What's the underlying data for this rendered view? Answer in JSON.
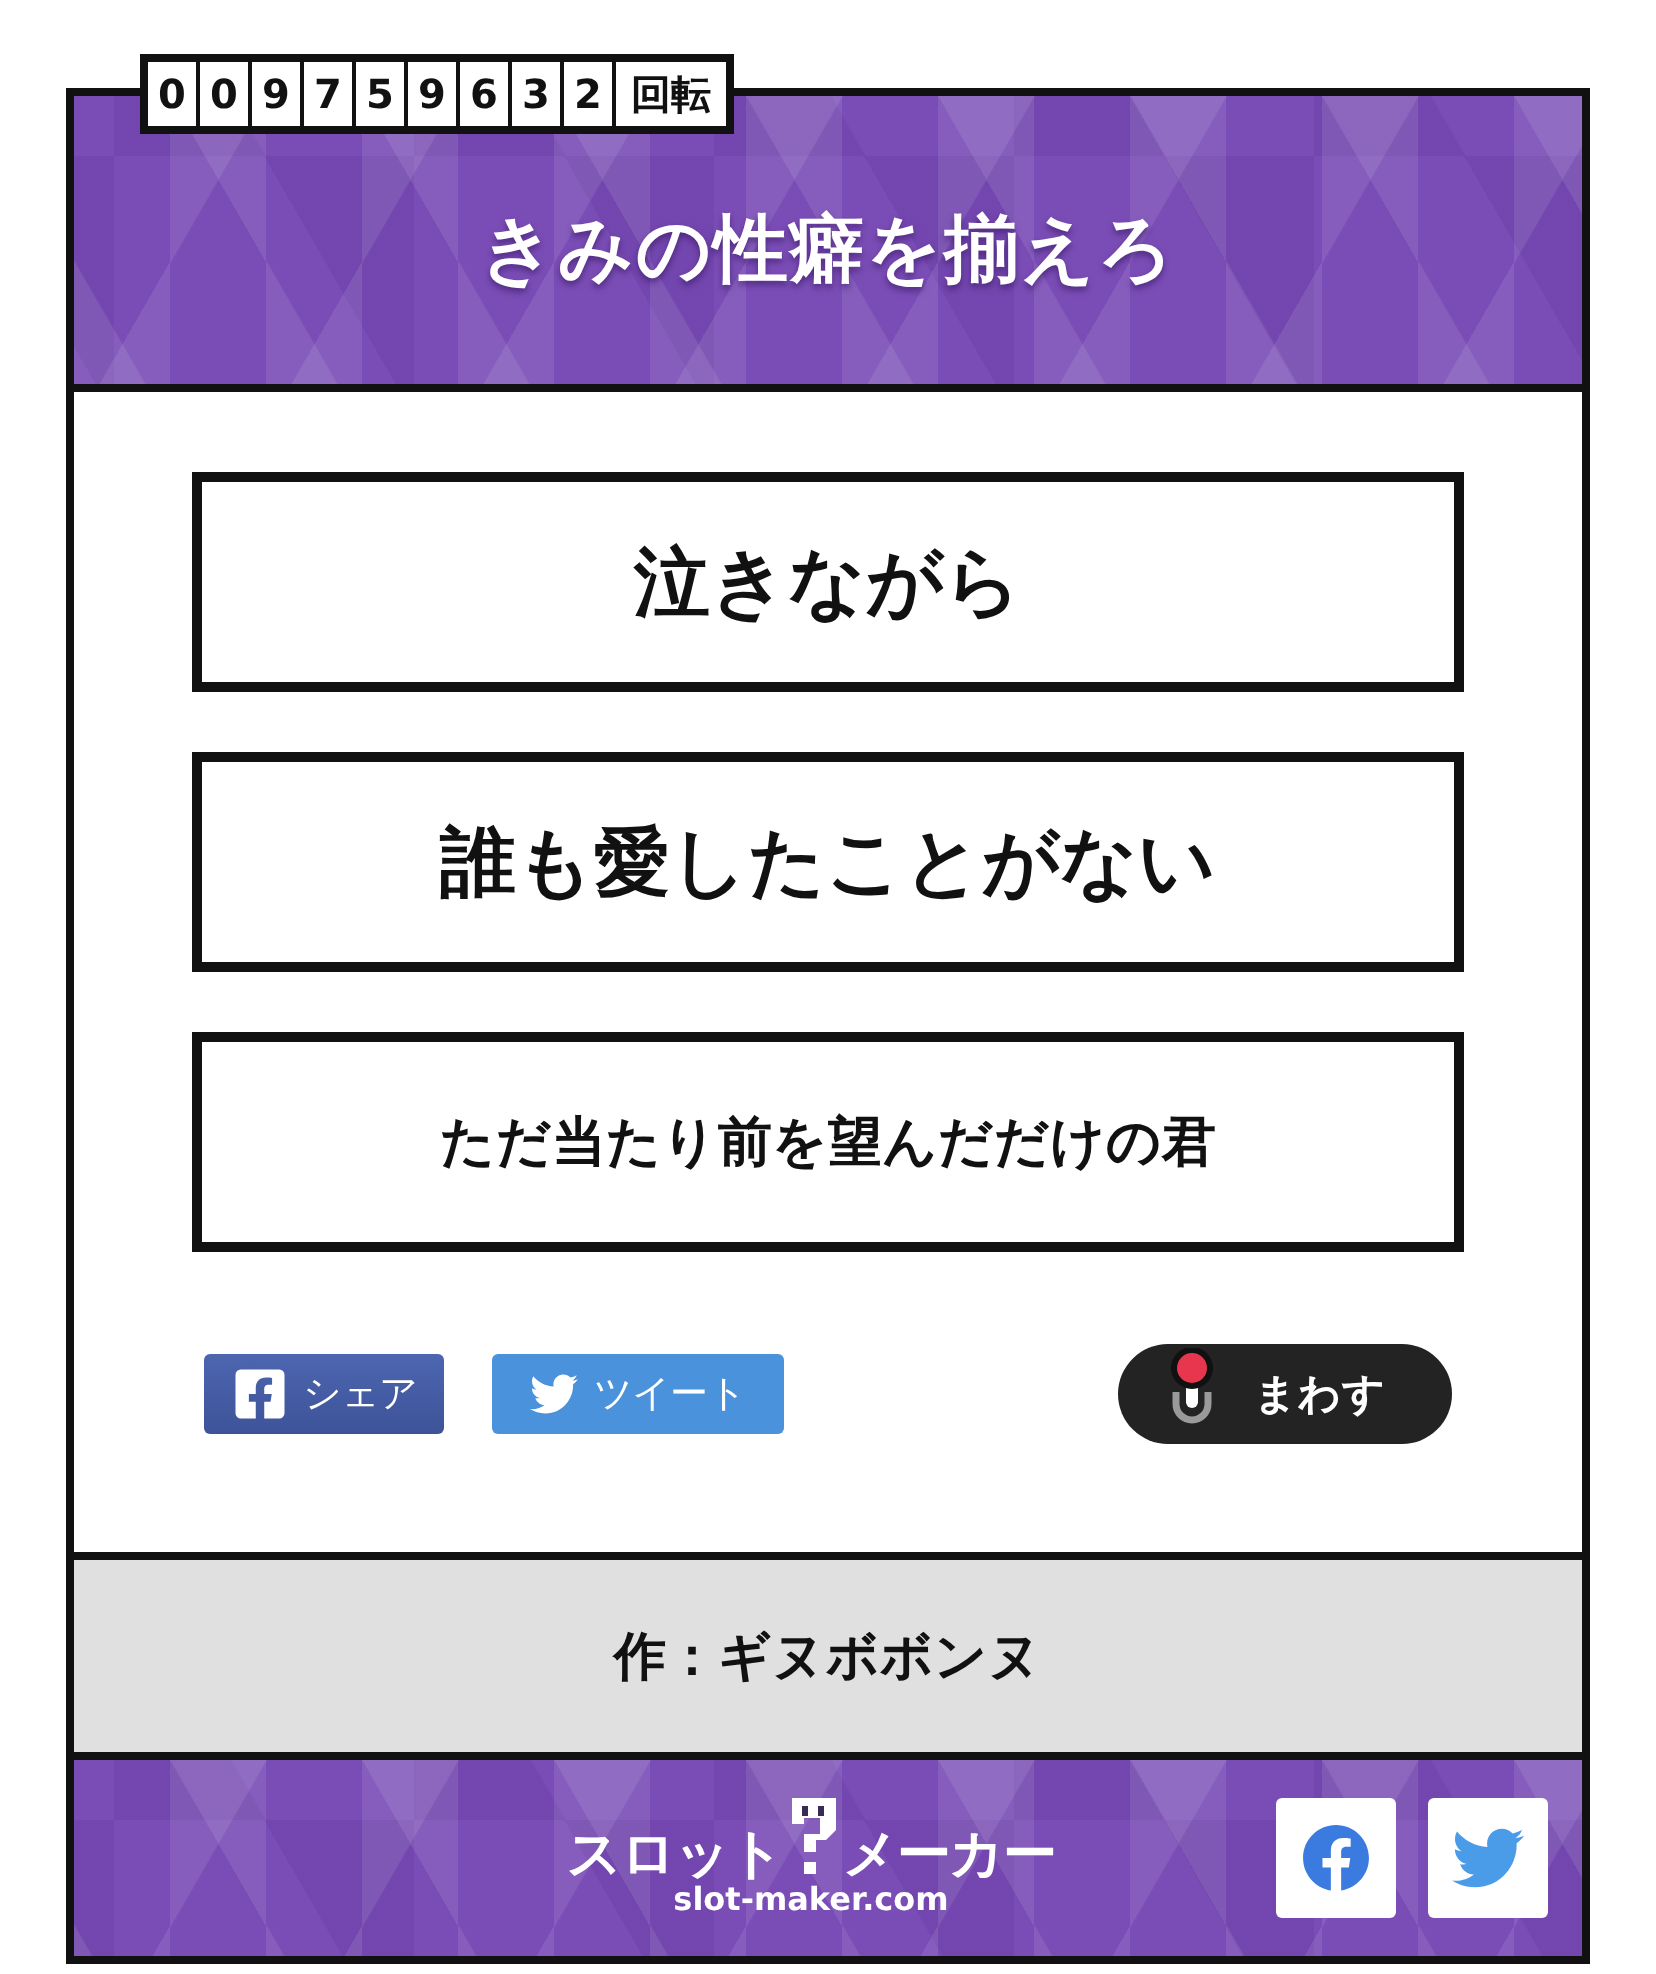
{
  "counter": {
    "digits": [
      "0",
      "0",
      "9",
      "7",
      "5",
      "9",
      "6",
      "3",
      "2"
    ],
    "unit": "回転"
  },
  "header": {
    "title": "きみの性癖を揃えろ"
  },
  "reels": [
    {
      "text": "泣きながら"
    },
    {
      "text": "誰も愛したことがない"
    },
    {
      "text": "ただ当たり前を望んだだけの君"
    }
  ],
  "share_buttons": [
    {
      "kind": "facebook",
      "label": "シェア"
    },
    {
      "kind": "twitter",
      "label": "ツイート"
    }
  ],
  "spin_button": {
    "label": "まわす"
  },
  "author": {
    "credit": "作：ギヌボボンヌ"
  },
  "footer": {
    "logo": {
      "left": "スロット",
      "right": "メーカー",
      "domain": "slot-maker.com"
    },
    "social": [
      {
        "kind": "facebook"
      },
      {
        "kind": "twitter"
      }
    ]
  }
}
